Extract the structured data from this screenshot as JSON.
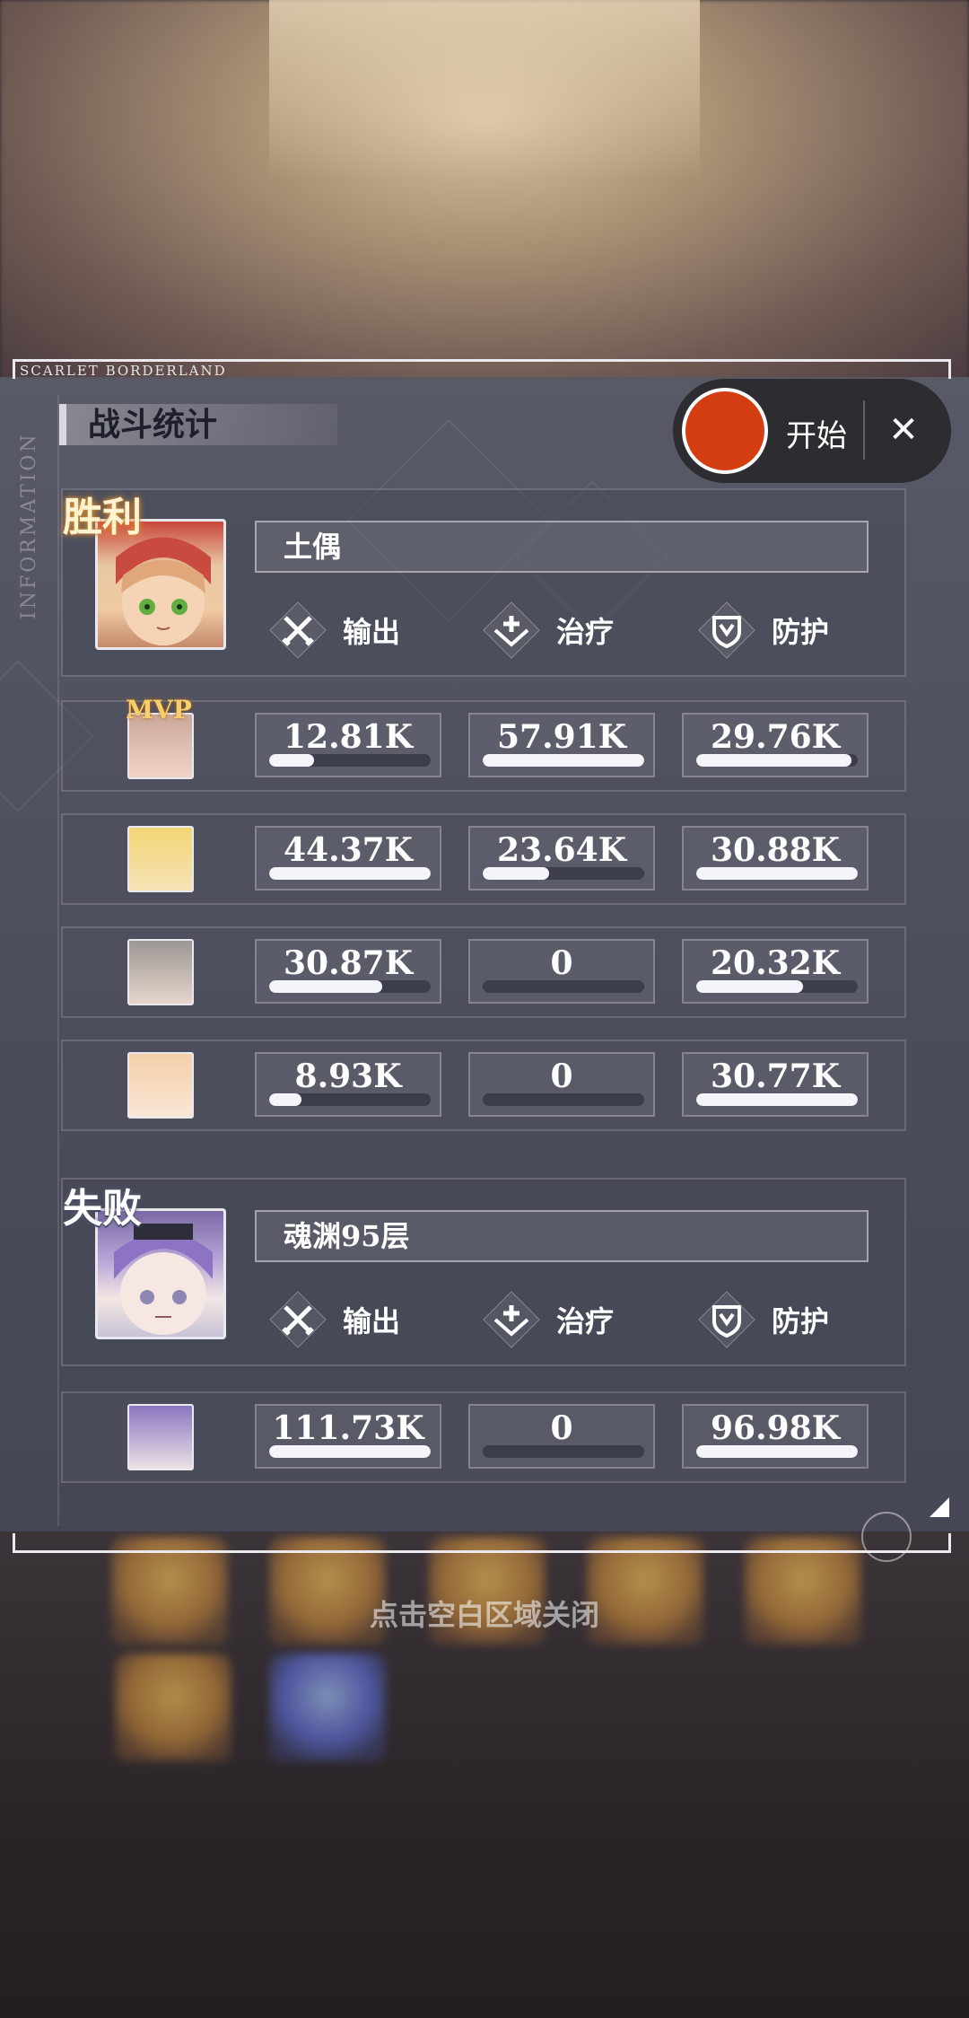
{
  "header": {
    "brand": "SCARLET BORDERLAND",
    "section_title": "战斗统计",
    "side_label": "INFORMATION"
  },
  "recorder": {
    "start_label": "开始",
    "close_label": "✕"
  },
  "team_win": {
    "result": "胜利",
    "name": "土偶",
    "stats": [
      "输出",
      "治疗",
      "防护"
    ],
    "rows": [
      {
        "mvp": "MVP",
        "dmg": "12.81K",
        "dmg_p": 0.28,
        "heal": "57.91K",
        "heal_p": 1.0,
        "def": "29.76K",
        "def_p": 0.96
      },
      {
        "mvp": "",
        "dmg": "44.37K",
        "dmg_p": 1.0,
        "heal": "23.64K",
        "heal_p": 0.41,
        "def": "30.88K",
        "def_p": 1.0
      },
      {
        "mvp": "",
        "dmg": "30.87K",
        "dmg_p": 0.7,
        "heal": "0",
        "heal_p": 0,
        "def": "20.32K",
        "def_p": 0.66
      },
      {
        "mvp": "",
        "dmg": "8.93K",
        "dmg_p": 0.2,
        "heal": "0",
        "heal_p": 0,
        "def": "30.77K",
        "def_p": 1.0
      }
    ]
  },
  "team_lose": {
    "result": "失败",
    "name": "魂渊95层",
    "stats": [
      "输出",
      "治疗",
      "防护"
    ],
    "rows": [
      {
        "dmg": "111.73K",
        "dmg_p": 1.0,
        "heal": "0",
        "heal_p": 0,
        "def": "96.98K",
        "def_p": 1.0
      }
    ]
  },
  "footer": {
    "close_hint": "点击空白区域关闭"
  },
  "colors": {
    "record_button": "#d43d12",
    "win_glow": "#e89a36",
    "mvp": "#f7cf6a"
  }
}
